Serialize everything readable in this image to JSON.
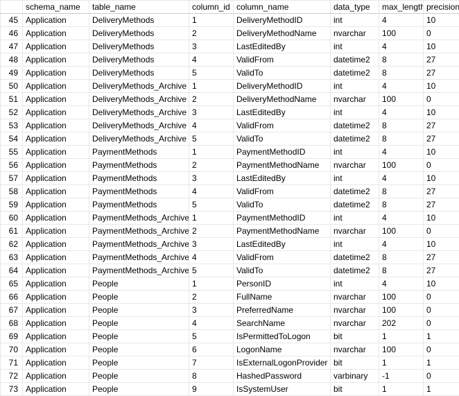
{
  "headers": {
    "row": "",
    "schema_name": "schema_name",
    "table_name": "table_name",
    "column_id": "column_id",
    "column_name": "column_name",
    "data_type": "data_type",
    "max_length": "max_length",
    "precision": "precision"
  },
  "rows": [
    {
      "n": "45",
      "schema": "Application",
      "table": "DeliveryMethods",
      "cid": "1",
      "col": "DeliveryMethodID",
      "dt": "int",
      "ml": "4",
      "pr": "10"
    },
    {
      "n": "46",
      "schema": "Application",
      "table": "DeliveryMethods",
      "cid": "2",
      "col": "DeliveryMethodName",
      "dt": "nvarchar",
      "ml": "100",
      "pr": "0"
    },
    {
      "n": "47",
      "schema": "Application",
      "table": "DeliveryMethods",
      "cid": "3",
      "col": "LastEditedBy",
      "dt": "int",
      "ml": "4",
      "pr": "10"
    },
    {
      "n": "48",
      "schema": "Application",
      "table": "DeliveryMethods",
      "cid": "4",
      "col": "ValidFrom",
      "dt": "datetime2",
      "ml": "8",
      "pr": "27"
    },
    {
      "n": "49",
      "schema": "Application",
      "table": "DeliveryMethods",
      "cid": "5",
      "col": "ValidTo",
      "dt": "datetime2",
      "ml": "8",
      "pr": "27"
    },
    {
      "n": "50",
      "schema": "Application",
      "table": "DeliveryMethods_Archive",
      "cid": "1",
      "col": "DeliveryMethodID",
      "dt": "int",
      "ml": "4",
      "pr": "10"
    },
    {
      "n": "51",
      "schema": "Application",
      "table": "DeliveryMethods_Archive",
      "cid": "2",
      "col": "DeliveryMethodName",
      "dt": "nvarchar",
      "ml": "100",
      "pr": "0"
    },
    {
      "n": "52",
      "schema": "Application",
      "table": "DeliveryMethods_Archive",
      "cid": "3",
      "col": "LastEditedBy",
      "dt": "int",
      "ml": "4",
      "pr": "10"
    },
    {
      "n": "53",
      "schema": "Application",
      "table": "DeliveryMethods_Archive",
      "cid": "4",
      "col": "ValidFrom",
      "dt": "datetime2",
      "ml": "8",
      "pr": "27"
    },
    {
      "n": "54",
      "schema": "Application",
      "table": "DeliveryMethods_Archive",
      "cid": "5",
      "col": "ValidTo",
      "dt": "datetime2",
      "ml": "8",
      "pr": "27"
    },
    {
      "n": "55",
      "schema": "Application",
      "table": "PaymentMethods",
      "cid": "1",
      "col": "PaymentMethodID",
      "dt": "int",
      "ml": "4",
      "pr": "10"
    },
    {
      "n": "56",
      "schema": "Application",
      "table": "PaymentMethods",
      "cid": "2",
      "col": "PaymentMethodName",
      "dt": "nvarchar",
      "ml": "100",
      "pr": "0"
    },
    {
      "n": "57",
      "schema": "Application",
      "table": "PaymentMethods",
      "cid": "3",
      "col": "LastEditedBy",
      "dt": "int",
      "ml": "4",
      "pr": "10"
    },
    {
      "n": "58",
      "schema": "Application",
      "table": "PaymentMethods",
      "cid": "4",
      "col": "ValidFrom",
      "dt": "datetime2",
      "ml": "8",
      "pr": "27"
    },
    {
      "n": "59",
      "schema": "Application",
      "table": "PaymentMethods",
      "cid": "5",
      "col": "ValidTo",
      "dt": "datetime2",
      "ml": "8",
      "pr": "27"
    },
    {
      "n": "60",
      "schema": "Application",
      "table": "PaymentMethods_Archive",
      "cid": "1",
      "col": "PaymentMethodID",
      "dt": "int",
      "ml": "4",
      "pr": "10"
    },
    {
      "n": "61",
      "schema": "Application",
      "table": "PaymentMethods_Archive",
      "cid": "2",
      "col": "PaymentMethodName",
      "dt": "nvarchar",
      "ml": "100",
      "pr": "0"
    },
    {
      "n": "62",
      "schema": "Application",
      "table": "PaymentMethods_Archive",
      "cid": "3",
      "col": "LastEditedBy",
      "dt": "int",
      "ml": "4",
      "pr": "10"
    },
    {
      "n": "63",
      "schema": "Application",
      "table": "PaymentMethods_Archive",
      "cid": "4",
      "col": "ValidFrom",
      "dt": "datetime2",
      "ml": "8",
      "pr": "27"
    },
    {
      "n": "64",
      "schema": "Application",
      "table": "PaymentMethods_Archive",
      "cid": "5",
      "col": "ValidTo",
      "dt": "datetime2",
      "ml": "8",
      "pr": "27"
    },
    {
      "n": "65",
      "schema": "Application",
      "table": "People",
      "cid": "1",
      "col": "PersonID",
      "dt": "int",
      "ml": "4",
      "pr": "10"
    },
    {
      "n": "66",
      "schema": "Application",
      "table": "People",
      "cid": "2",
      "col": "FullName",
      "dt": "nvarchar",
      "ml": "100",
      "pr": "0"
    },
    {
      "n": "67",
      "schema": "Application",
      "table": "People",
      "cid": "3",
      "col": "PreferredName",
      "dt": "nvarchar",
      "ml": "100",
      "pr": "0"
    },
    {
      "n": "68",
      "schema": "Application",
      "table": "People",
      "cid": "4",
      "col": "SearchName",
      "dt": "nvarchar",
      "ml": "202",
      "pr": "0"
    },
    {
      "n": "69",
      "schema": "Application",
      "table": "People",
      "cid": "5",
      "col": "IsPermittedToLogon",
      "dt": "bit",
      "ml": "1",
      "pr": "1"
    },
    {
      "n": "70",
      "schema": "Application",
      "table": "People",
      "cid": "6",
      "col": "LogonName",
      "dt": "nvarchar",
      "ml": "100",
      "pr": "0"
    },
    {
      "n": "71",
      "schema": "Application",
      "table": "People",
      "cid": "7",
      "col": "IsExternalLogonProvider",
      "dt": "bit",
      "ml": "1",
      "pr": "1"
    },
    {
      "n": "72",
      "schema": "Application",
      "table": "People",
      "cid": "8",
      "col": "HashedPassword",
      "dt": "varbinary",
      "ml": "-1",
      "pr": "0"
    },
    {
      "n": "73",
      "schema": "Application",
      "table": "People",
      "cid": "9",
      "col": "IsSystemUser",
      "dt": "bit",
      "ml": "1",
      "pr": "1"
    }
  ]
}
